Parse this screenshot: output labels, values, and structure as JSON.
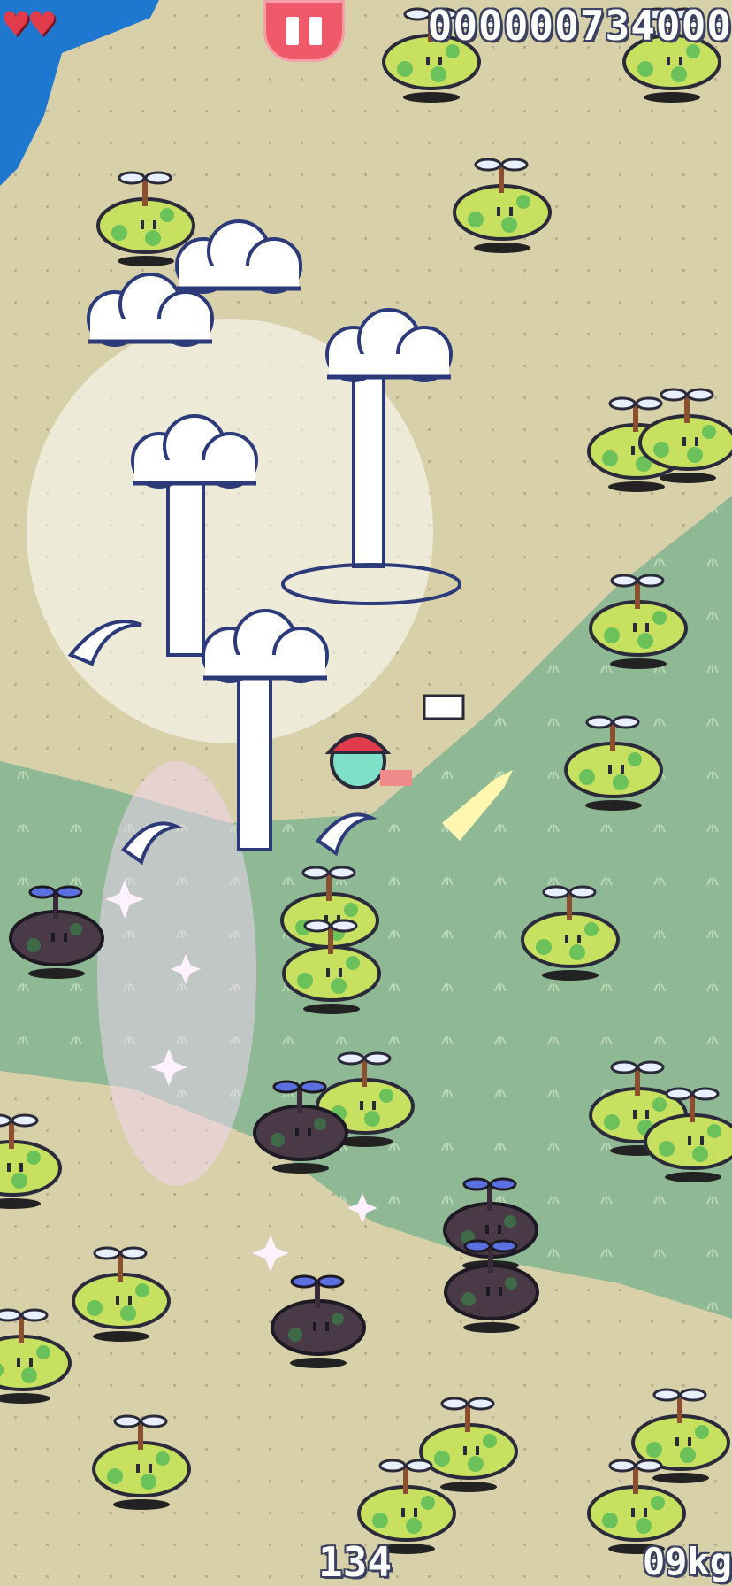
{
  "hud": {
    "lives": 2,
    "score": "000000734000",
    "combo": "134",
    "weight": "09kg"
  },
  "palette": {
    "sand": "#d8d0a8",
    "grass": "#8fb894",
    "water": "#1e78d0",
    "heart": "#e23b4c",
    "pause": "#ef5a6a",
    "sprout_body": "#c8e060",
    "sprout_spot": "#6cc25a",
    "sprout_dark": "#4a3a48",
    "cloud": "#ffffff",
    "outline": "#2a2a3a"
  },
  "icons": [
    "heart-icon",
    "pause-icon"
  ]
}
